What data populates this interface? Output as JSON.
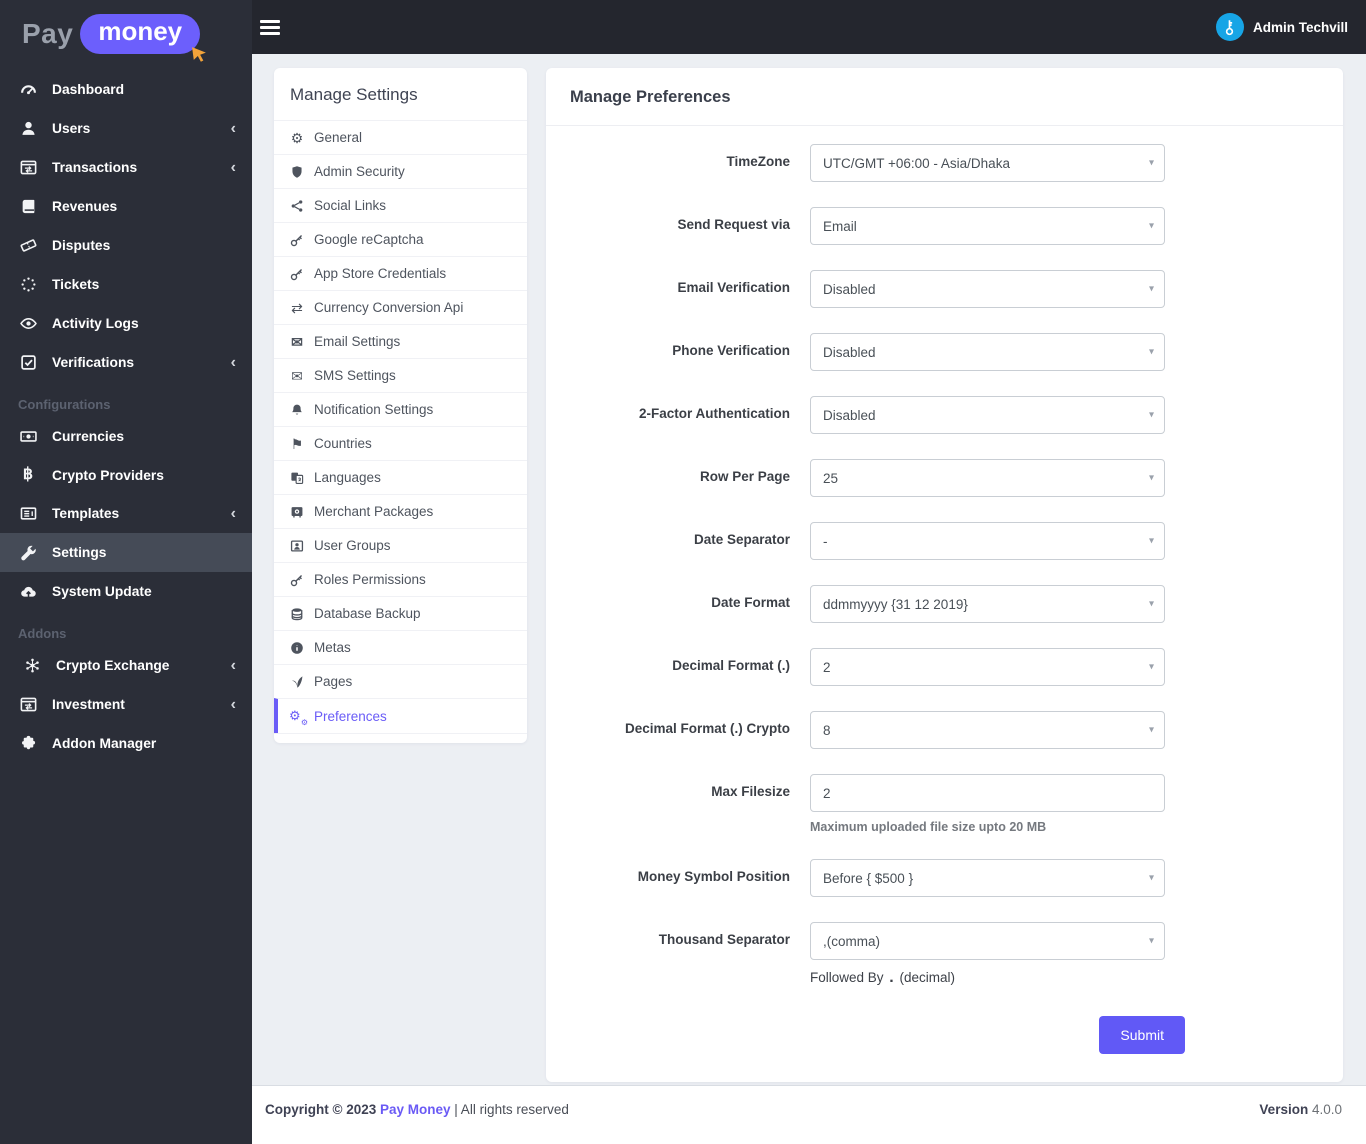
{
  "logo": {
    "part1": "Pay",
    "part2": "money"
  },
  "topbar": {
    "user_name": "Admin Techvill"
  },
  "sidebar": {
    "items": [
      {
        "type": "item",
        "icon": "gauge-icon",
        "label": "Dashboard"
      },
      {
        "type": "item",
        "icon": "user-icon",
        "label": "Users",
        "chevron": true
      },
      {
        "type": "item",
        "icon": "window-arrows-icon",
        "label": "Transactions",
        "chevron": true
      },
      {
        "type": "item",
        "icon": "book-icon",
        "label": "Revenues"
      },
      {
        "type": "item",
        "icon": "ticket-icon",
        "label": "Disputes"
      },
      {
        "type": "item",
        "icon": "spinner-icon",
        "label": "Tickets"
      },
      {
        "type": "item",
        "icon": "eye-icon",
        "label": "Activity Logs"
      },
      {
        "type": "item",
        "icon": "check-square-icon",
        "label": "Verifications",
        "chevron": true
      },
      {
        "type": "section",
        "label": "Configurations"
      },
      {
        "type": "item",
        "icon": "money-bill-icon",
        "label": "Currencies"
      },
      {
        "type": "item",
        "icon": "bitcoin-icon",
        "label": "Crypto Providers"
      },
      {
        "type": "item",
        "icon": "newspaper-icon",
        "label": "Templates",
        "chevron": true
      },
      {
        "type": "item",
        "icon": "wrench-icon",
        "label": "Settings",
        "active": true
      },
      {
        "type": "item",
        "icon": "cloud-upload-icon",
        "label": "System Update"
      },
      {
        "type": "section",
        "label": "Addons"
      },
      {
        "type": "item",
        "icon": "molecule-icon",
        "label": "Crypto Exchange",
        "chevron": true,
        "indent": true
      },
      {
        "type": "item",
        "icon": "window-arrows-icon",
        "label": "Investment",
        "chevron": true
      },
      {
        "type": "item",
        "icon": "puzzle-icon",
        "label": "Addon Manager"
      }
    ]
  },
  "settings_nav": {
    "title": "Manage Settings",
    "items": [
      {
        "icon": "gear-icon",
        "label": "General"
      },
      {
        "icon": "shield-icon",
        "label": "Admin Security"
      },
      {
        "icon": "share-icon",
        "label": "Social Links"
      },
      {
        "icon": "key-icon",
        "label": "Google reCaptcha"
      },
      {
        "icon": "key-icon",
        "label": "App Store Credentials"
      },
      {
        "icon": "exchange-icon",
        "label": "Currency Conversion Api"
      },
      {
        "icon": "envelope-icon",
        "label": "Email Settings"
      },
      {
        "icon": "envelope-open-icon",
        "label": "SMS Settings"
      },
      {
        "icon": "bell-icon",
        "label": "Notification Settings"
      },
      {
        "icon": "flag-icon",
        "label": "Countries"
      },
      {
        "icon": "language-icon",
        "label": "Languages"
      },
      {
        "icon": "vault-icon",
        "label": "Merchant Packages"
      },
      {
        "icon": "user-frame-icon",
        "label": "User Groups"
      },
      {
        "icon": "key-icon",
        "label": "Roles Permissions"
      },
      {
        "icon": "database-icon",
        "label": "Database Backup"
      },
      {
        "icon": "info-icon",
        "label": "Metas"
      },
      {
        "icon": "leaf-icon",
        "label": "Pages"
      },
      {
        "icon": "cogs-icon",
        "label": "Preferences",
        "active": true
      }
    ]
  },
  "preferences": {
    "title": "Manage Preferences",
    "rows": [
      {
        "label": "TimeZone",
        "value": "UTC/GMT +06:00 - Asia/Dhaka",
        "type": "select"
      },
      {
        "label": "Send Request via",
        "value": "Email",
        "type": "select"
      },
      {
        "label": "Email Verification",
        "value": "Disabled",
        "type": "select"
      },
      {
        "label": "Phone Verification",
        "value": "Disabled",
        "type": "select"
      },
      {
        "label": "2-Factor Authentication",
        "value": "Disabled",
        "type": "select"
      },
      {
        "label": "Row Per Page",
        "value": "25",
        "type": "select"
      },
      {
        "label": "Date Separator",
        "value": "-",
        "type": "select"
      },
      {
        "label": "Date Format",
        "value": "ddmmyyyy {31 12 2019}",
        "type": "select"
      },
      {
        "label": "Decimal Format (.)",
        "value": "2",
        "type": "select"
      },
      {
        "label": "Decimal Format (.) Crypto",
        "value": "8",
        "type": "select"
      },
      {
        "label": "Max Filesize",
        "value": "2",
        "type": "input",
        "helper": "Maximum uploaded file size upto 20 MB"
      },
      {
        "label": "Money Symbol Position",
        "value": "Before { $500 }",
        "type": "select"
      },
      {
        "label": "Thousand Separator",
        "value": ",(comma)",
        "type": "select",
        "helper_parts": {
          "pre": "Followed By",
          "dot": ".",
          "post": "(decimal)"
        }
      }
    ],
    "submit_label": "Submit"
  },
  "footer": {
    "copyright_prefix": "Copyright © 2023",
    "brand": "Pay Money",
    "suffix": "| All rights reserved",
    "version_label": "Version",
    "version_value": "4.0.0"
  },
  "colors": {
    "accent": "#6a5cf7",
    "submit": "#6159f6",
    "avatar": "#17a5e6",
    "logo_pill": "#6c5ffc"
  }
}
